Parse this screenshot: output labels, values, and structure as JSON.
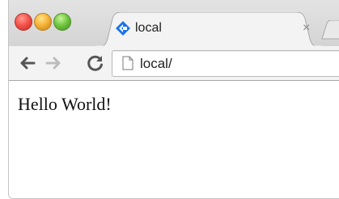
{
  "window": {
    "controls": [
      "close",
      "minimize",
      "maximize"
    ],
    "colors": {
      "close": "#f5544b",
      "minimize": "#f6b43a",
      "maximize": "#73c742"
    }
  },
  "tab": {
    "title": "local",
    "favicon": "diamond-arrows-icon",
    "close_label": "×",
    "accent": "#1a73e8"
  },
  "toolbar": {
    "back_icon": "back-arrow-icon",
    "forward_icon": "forward-arrow-icon",
    "reload_icon": "reload-icon"
  },
  "address_bar": {
    "icon": "page-icon",
    "url": "local/"
  },
  "page": {
    "body_text": "Hello World!"
  }
}
